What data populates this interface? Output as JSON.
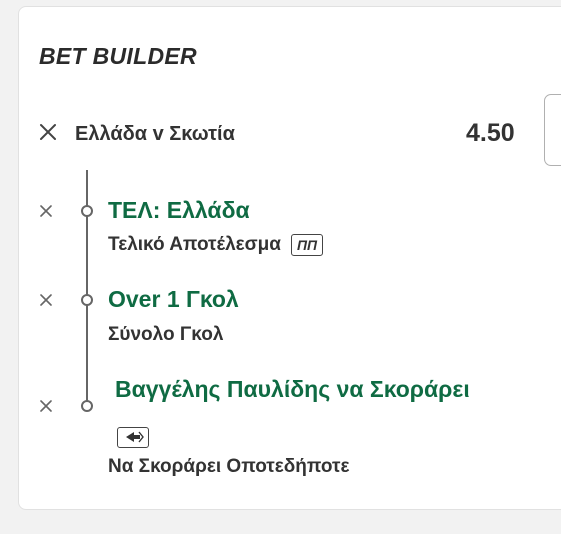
{
  "bet_builder": {
    "title": "BET BUILDER",
    "match": "Ελλάδα v Σκωτία",
    "odds": "4.50",
    "selections": [
      {
        "name": "ΤΕΛ: Ελλάδα",
        "market": "Τελικό Αποτέλεσμα",
        "badge": "ΠΠ"
      },
      {
        "name": "Over 1 Γκολ",
        "market": "Σύνολο Γκολ"
      },
      {
        "name": "Βαγγέλης Παυλίδης να Σκοράρει",
        "market": "Να Σκοράρει Οποτεδήποτε",
        "badge_icon": "swap-arrow-icon"
      }
    ]
  },
  "colors": {
    "selection_green": "#0f6b43",
    "text_dark": "#333333",
    "card_border": "#e1e1e1"
  }
}
